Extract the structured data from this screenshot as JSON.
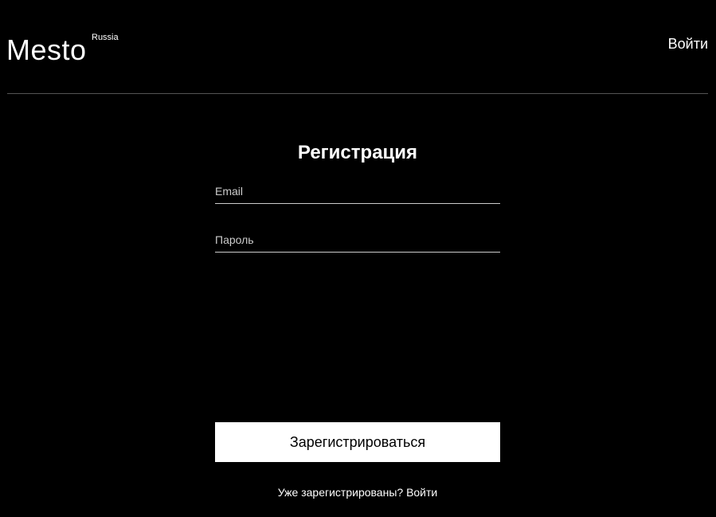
{
  "header": {
    "logo": {
      "text": "Mesto",
      "superscript": "Russia"
    },
    "login_link": "Войти"
  },
  "register_form": {
    "title": "Регистрация",
    "email_field": {
      "placeholder": "Email",
      "value": ""
    },
    "password_field": {
      "placeholder": "Пароль",
      "value": ""
    },
    "submit_label": "Зарегистрироваться",
    "hint_text": "Уже зарегистрированы?",
    "hint_link": "Войти"
  },
  "colors": {
    "background": "#000000",
    "text": "#ffffff",
    "divider": "#545454",
    "button_background": "#ffffff",
    "button_text": "#000000"
  }
}
